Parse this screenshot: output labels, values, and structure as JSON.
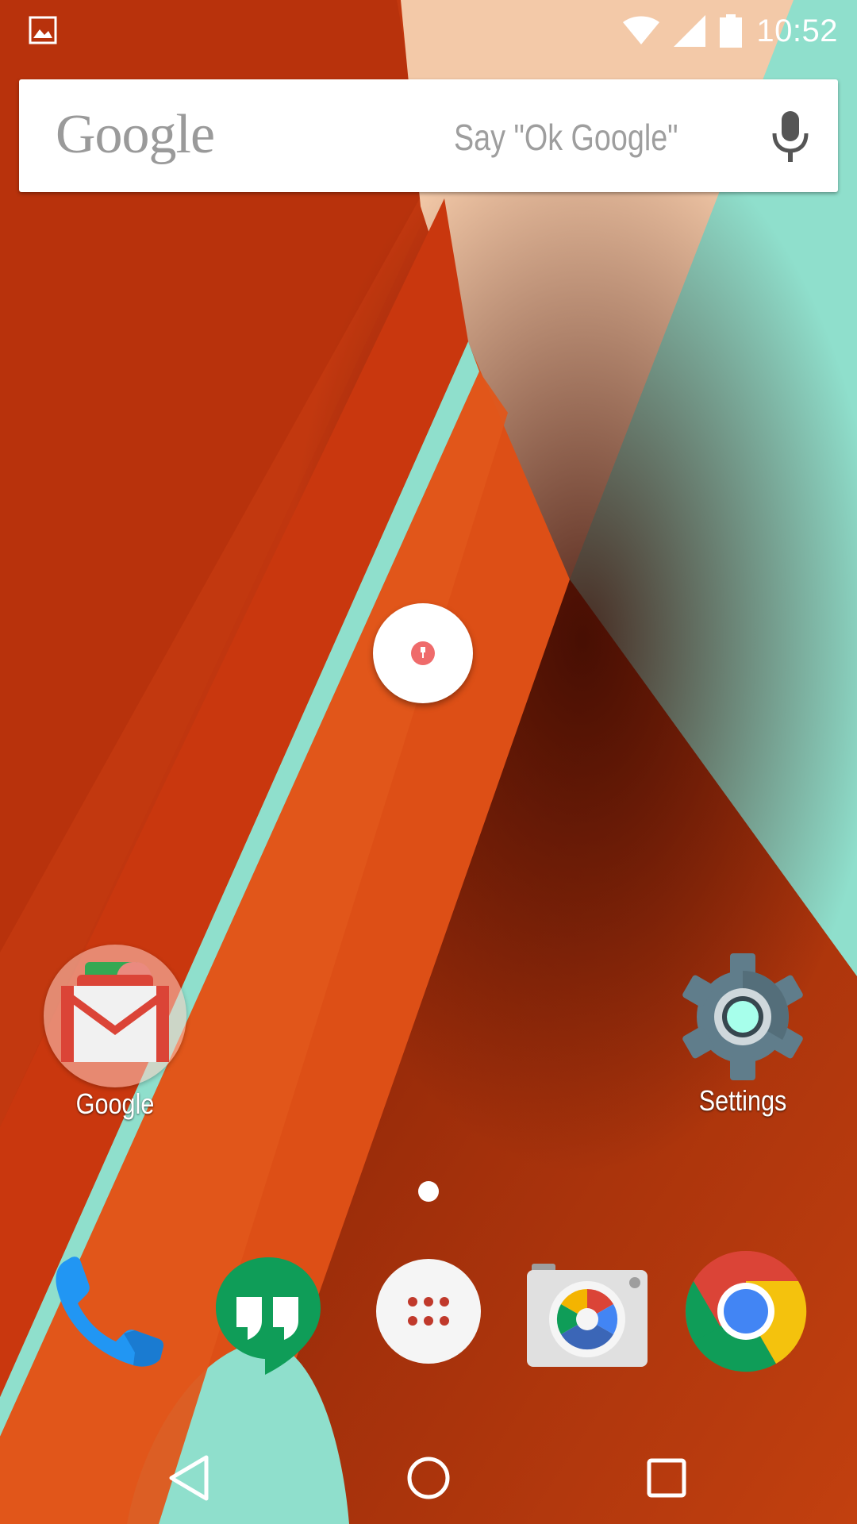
{
  "status_bar": {
    "time": "10:52",
    "notification_icon": "image-icon",
    "wifi_icon": "wifi-icon",
    "signal_icon": "cell-signal-icon",
    "battery_icon": "battery-icon"
  },
  "search_bar": {
    "logo_text": "Google",
    "hint": "Say \"Ok Google\"",
    "mic_icon": "microphone-icon"
  },
  "floating_bubble": {
    "icon": "pin-icon",
    "accent_color": "#ef6b6b"
  },
  "home_apps": [
    {
      "label": "Google",
      "icon": "google-folder-icon"
    },
    {
      "label": "Settings",
      "icon": "settings-gear-icon"
    }
  ],
  "page_indicator": {
    "pages": 1,
    "current": 1
  },
  "dock": [
    {
      "name": "Phone",
      "icon": "phone-icon"
    },
    {
      "name": "Hangouts",
      "icon": "hangouts-icon"
    },
    {
      "name": "Apps",
      "icon": "app-drawer-icon"
    },
    {
      "name": "Camera",
      "icon": "camera-icon"
    },
    {
      "name": "Chrome",
      "icon": "chrome-icon"
    }
  ],
  "nav_bar": {
    "back_icon": "back-triangle-icon",
    "home_icon": "home-circle-icon",
    "recents_icon": "recents-square-icon"
  },
  "colors": {
    "wallpaper_red": "#c0360f",
    "wallpaper_orange": "#dd4f16",
    "wallpaper_teal": "#8fdfcc",
    "wallpaper_peach": "#f3c9a8",
    "gmail_red": "#db4437",
    "hangouts_green": "#0f9d58",
    "chrome_blue": "#4285f4",
    "phone_blue": "#2196f3",
    "settings_gray": "#607d8b"
  }
}
